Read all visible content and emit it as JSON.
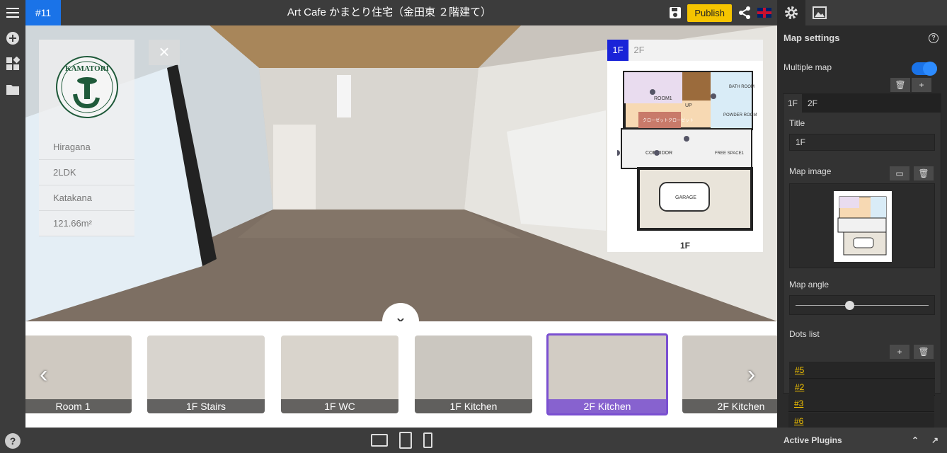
{
  "topbar": {
    "project_id": "#11",
    "title": "Art Cafe かまとり住宅（金田東 ２階建て）",
    "publish_label": "Publish"
  },
  "info_card": {
    "logo_text": "KAMATORI",
    "rows": [
      "Hiragana",
      "2LDK",
      "Katakana",
      "121.66m²"
    ]
  },
  "map_panel": {
    "tabs": [
      "1F",
      "2F"
    ],
    "active_tab": "1F",
    "floor_label": "1F",
    "room_labels": [
      "ROOM1",
      "UP",
      "BATH ROOM",
      "POWDER ROOM",
      "クローゼット",
      "クローゼット",
      "CORRIDOR",
      "FREE SPACE1",
      "GARAGE"
    ]
  },
  "thumbnails": [
    {
      "label": "Room 1",
      "active": false
    },
    {
      "label": "1F Stairs",
      "active": false
    },
    {
      "label": "1F WC",
      "active": false
    },
    {
      "label": "1F Kitchen",
      "active": false
    },
    {
      "label": "2F Kitchen",
      "active": true
    },
    {
      "label": "2F Kitchen",
      "active": false
    }
  ],
  "sidebar": {
    "header": "Map settings",
    "multiple_map_label": "Multiple map",
    "multiple_map_enabled": true,
    "floor_tabs": [
      "1F",
      "2F"
    ],
    "title_label": "Title",
    "title_value": "1F",
    "map_image_label": "Map image",
    "map_angle_label": "Map angle",
    "map_angle_value": 0.5,
    "dots_list_label": "Dots list",
    "dots": [
      "#5",
      "#2",
      "#3",
      "#6"
    ]
  },
  "footer": {
    "active_plugins": "Active Plugins"
  },
  "colors": {
    "accent": "#1a73e8",
    "publish": "#f5c400",
    "active_thumb": "#7a4fd1",
    "map_tab": "#1a24d8"
  }
}
